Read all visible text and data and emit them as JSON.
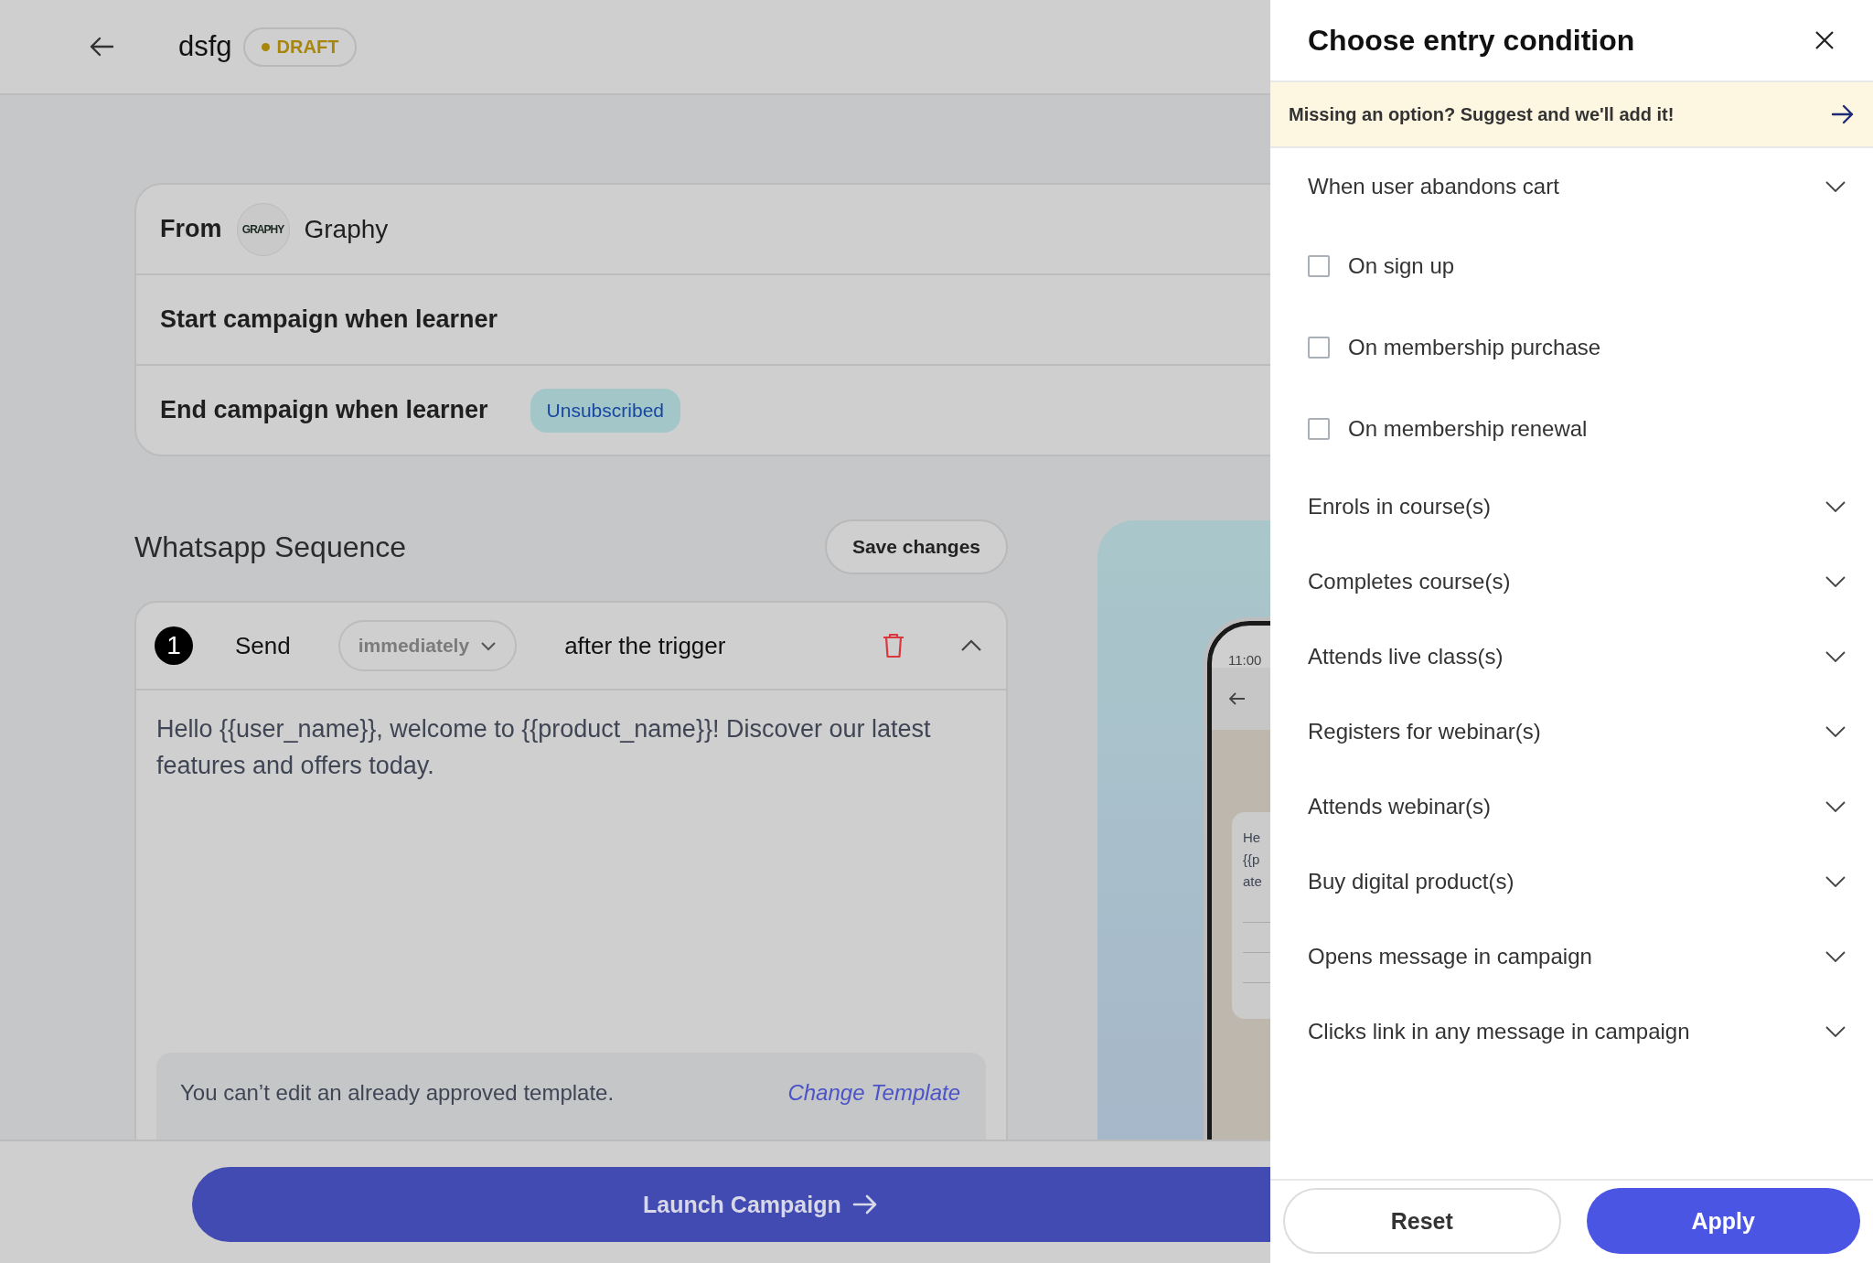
{
  "header": {
    "title": "dsfg",
    "status": "DRAFT"
  },
  "campaign": {
    "from_label": "From",
    "sender_logo": "GRAPHY",
    "sender_name": "Graphy",
    "start_label": "Start campaign when learner",
    "end_label": "End campaign when learner",
    "end_tag": "Unsubscribed"
  },
  "sequence": {
    "title": "Whatsapp Sequence",
    "save_button": "Save changes",
    "steps": [
      {
        "number": "1",
        "send_label": "Send",
        "timing": "immediately",
        "after_label": "after the trigger",
        "expanded": true,
        "message": "Hello {{user_name}}, welcome to {{product_name}}! Discover our latest features and offers today.",
        "notice": "You can’t edit an already approved template.",
        "notice_link": "Change Template"
      }
    ]
  },
  "phone_preview": {
    "time": "11:00",
    "message_lines": [
      "He",
      "{{p",
      "ate"
    ]
  },
  "launch_button": "Launch Campaign",
  "drawer": {
    "title": "Choose entry condition",
    "banner": "Missing an option? Suggest and we'll add it!",
    "options": [
      {
        "kind": "group",
        "label": "When user abandons cart",
        "expanded": false
      },
      {
        "kind": "checkbox",
        "label": "On sign up",
        "checked": false
      },
      {
        "kind": "checkbox",
        "label": "On membership purchase",
        "checked": false
      },
      {
        "kind": "checkbox",
        "label": "On membership renewal",
        "checked": false
      },
      {
        "kind": "group",
        "label": "Enrols in course(s)",
        "expanded": false
      },
      {
        "kind": "group",
        "label": "Completes course(s)",
        "expanded": false
      },
      {
        "kind": "group",
        "label": "Attends live class(s)",
        "expanded": false
      },
      {
        "kind": "group",
        "label": "Registers for webinar(s)",
        "expanded": false
      },
      {
        "kind": "group",
        "label": "Attends webinar(s)",
        "expanded": false
      },
      {
        "kind": "group",
        "label": "Buy digital product(s)",
        "expanded": false
      },
      {
        "kind": "group",
        "label": "Opens message in campaign",
        "expanded": false
      },
      {
        "kind": "group",
        "label": "Clicks link in any message in campaign",
        "expanded": false
      }
    ],
    "reset_button": "Reset",
    "apply_button": "Apply"
  }
}
